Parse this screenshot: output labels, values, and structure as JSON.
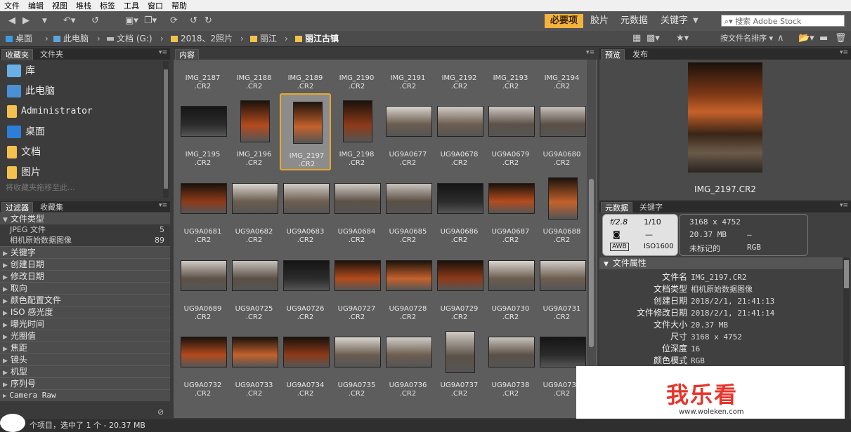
{
  "menubar": [
    "文件",
    "编辑",
    "视图",
    "堆栈",
    "标签",
    "工具",
    "窗口",
    "帮助"
  ],
  "toolbar": {
    "workspaces": [
      "必要项",
      "胶片",
      "元数据",
      "关键字"
    ],
    "search_placeholder": "搜索 Adobe Stock"
  },
  "path": [
    "桌面",
    "此电脑",
    "文档 (G:)",
    "2018、2照片",
    "丽江",
    "丽江古镇"
  ],
  "pathbar_right": {
    "sort_label": "按文件名排序"
  },
  "favorites": {
    "tabs": [
      "收藏夹",
      "文件夹"
    ],
    "items": [
      "库",
      "此电脑",
      "Administrator",
      "桌面",
      "文档",
      "图片"
    ],
    "hint": "将收藏夹拖移至此..."
  },
  "filter": {
    "tabs": [
      "过滤器",
      "收藏集"
    ],
    "sections": [
      "文件类型",
      "关键字",
      "创建日期",
      "修改日期",
      "取向",
      "颜色配置文件",
      "ISO 感光度",
      "曝光时间",
      "光圈值",
      "焦距",
      "镜头",
      "机型",
      "序列号",
      "Camera Raw"
    ],
    "filetype_rows": [
      {
        "name": "JPEG 文件",
        "count": "5"
      },
      {
        "name": "相机原始数据图像",
        "count": "89"
      }
    ]
  },
  "content": {
    "tab": "内容",
    "top_labels": [
      "IMG_2187",
      "IMG_2188",
      "IMG_2189",
      "IMG_2190",
      "IMG_2191",
      "IMG_2192",
      "IMG_2193",
      "IMG_2194"
    ],
    "rows": [
      [
        "IMG_2195",
        "IMG_2196",
        "IMG_2197",
        "IMG_2198",
        "UG9A0677",
        "UG9A0678",
        "UG9A0679",
        "UG9A0680"
      ],
      [
        "UG9A0681",
        "UG9A0682",
        "UG9A0683",
        "UG9A0684",
        "UG9A0685",
        "UG9A0686",
        "UG9A0687",
        "UG9A0688"
      ],
      [
        "UG9A0689",
        "UG9A0725",
        "UG9A0726",
        "UG9A0727",
        "UG9A0728",
        "UG9A0729",
        "UG9A0730",
        "UG9A0731"
      ],
      [
        "UG9A0732",
        "UG9A0733",
        "UG9A0734",
        "UG9A0735",
        "UG9A0736",
        "UG9A0737",
        "UG9A0738",
        "UG9A0739"
      ]
    ],
    "ext": ".CR2",
    "selected": "IMG_2197"
  },
  "preview": {
    "tabs": [
      "预览",
      "发布"
    ],
    "caption": "IMG_2197.CR2"
  },
  "metadata": {
    "tabs": [
      "元数据",
      "关键字"
    ],
    "exif": {
      "aperture": "f/2.8",
      "shutter": "1/10",
      "dash1": "—",
      "wb": "AWB",
      "iso": "ISO1600",
      "dims": "3168 x 4752",
      "size": "20.37 MB",
      "dash2": "—",
      "label": "未标记的",
      "mode": "RGB"
    },
    "section": "文件属性",
    "props": [
      {
        "k": "文件名",
        "v": "IMG_2197.CR2"
      },
      {
        "k": "文档类型",
        "v": "相机原始数据图像"
      },
      {
        "k": "创建日期",
        "v": "2018/2/1, 21:41:13"
      },
      {
        "k": "文件修改日期",
        "v": "2018/2/1, 21:41:14"
      },
      {
        "k": "文件大小",
        "v": "20.37 MB"
      },
      {
        "k": "尺寸",
        "v": "3168 x 4752"
      },
      {
        "k": "位深度",
        "v": "16"
      },
      {
        "k": "颜色模式",
        "v": "RGB"
      }
    ]
  },
  "status": {
    "text": "个项目，选中了 1 个 - 20.37 MB"
  },
  "watermark": {
    "title": "我乐看",
    "url": "www.woleken.com"
  }
}
